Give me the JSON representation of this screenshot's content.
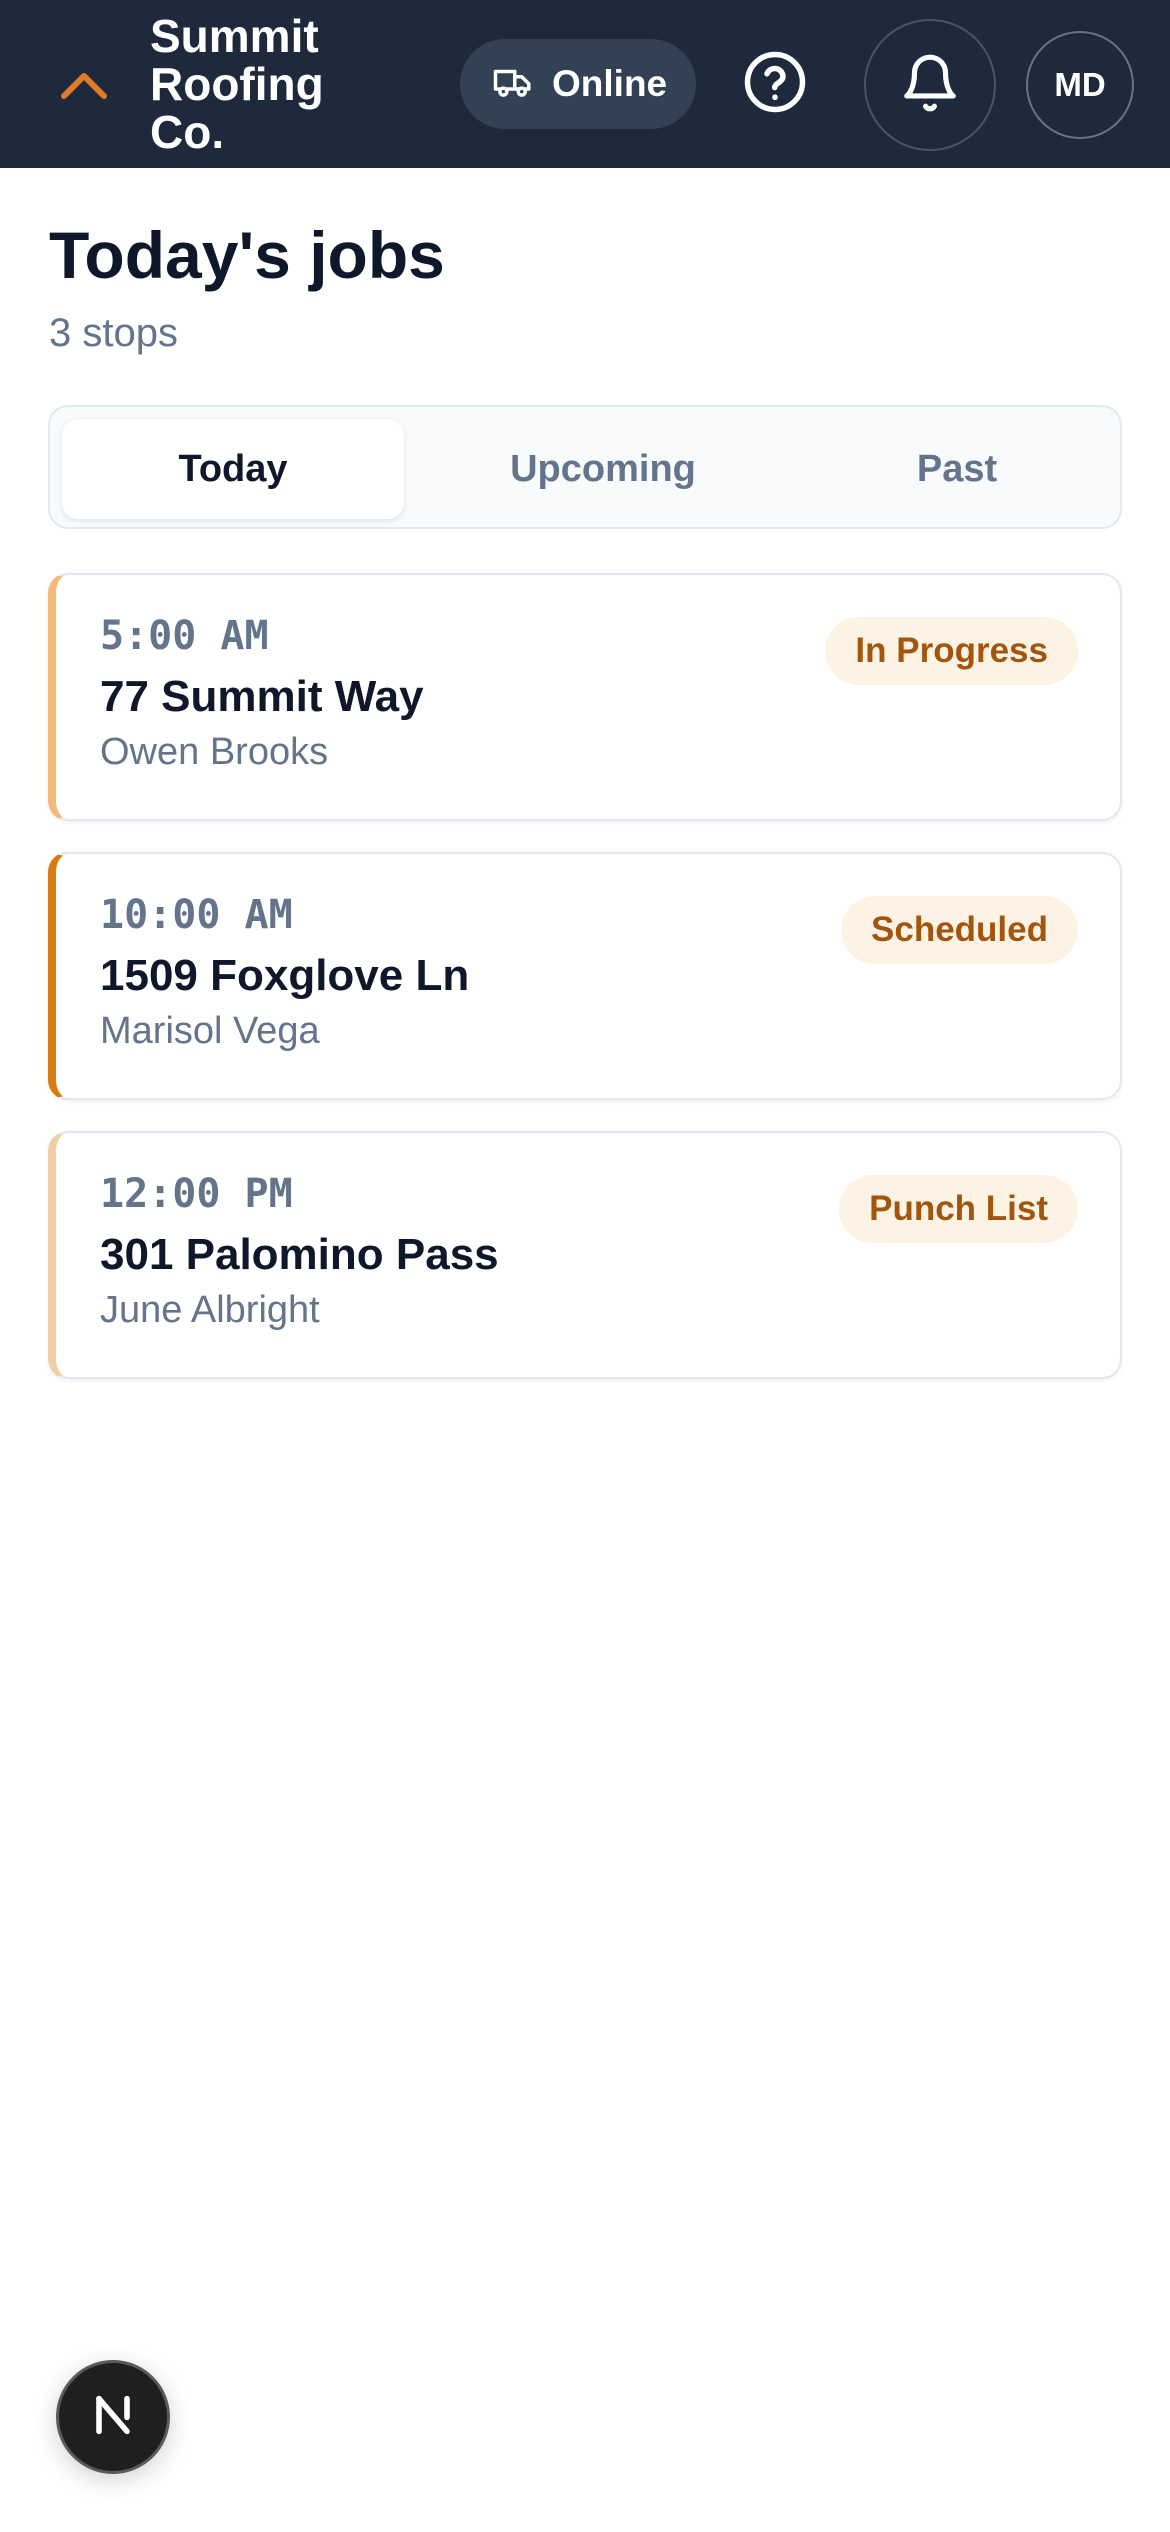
{
  "header": {
    "company_name": "Summit Roofing Co.",
    "status_label": "Online",
    "avatar_initials": "MD"
  },
  "page": {
    "title": "Today's jobs",
    "subtitle": "3 stops"
  },
  "tabs": [
    {
      "label": "Today",
      "active": true
    },
    {
      "label": "Upcoming",
      "active": false
    },
    {
      "label": "Past",
      "active": false
    }
  ],
  "jobs": [
    {
      "time": "5:00 AM",
      "address": "77 Summit Way",
      "customer": "Owen Brooks",
      "status": "In Progress",
      "accent": "#f2b97a"
    },
    {
      "time": "10:00 AM",
      "address": "1509 Foxglove Ln",
      "customer": "Marisol Vega",
      "status": "Scheduled",
      "accent": "#d97a12"
    },
    {
      "time": "12:00 PM",
      "address": "301 Palomino Pass",
      "customer": "June Albright",
      "status": "Punch List",
      "accent": "#f1cfa6"
    }
  ],
  "icons": {
    "logo": "chevron-up-icon",
    "status": "truck-icon",
    "help": "question-circle-icon",
    "notifications": "bell-icon",
    "dev_badge": "n-logo-icon"
  },
  "colors": {
    "header_bg": "#1e293b",
    "brand_accent": "#e07b2a",
    "badge_bg": "#fdf3e4",
    "badge_text": "#a2560d"
  }
}
